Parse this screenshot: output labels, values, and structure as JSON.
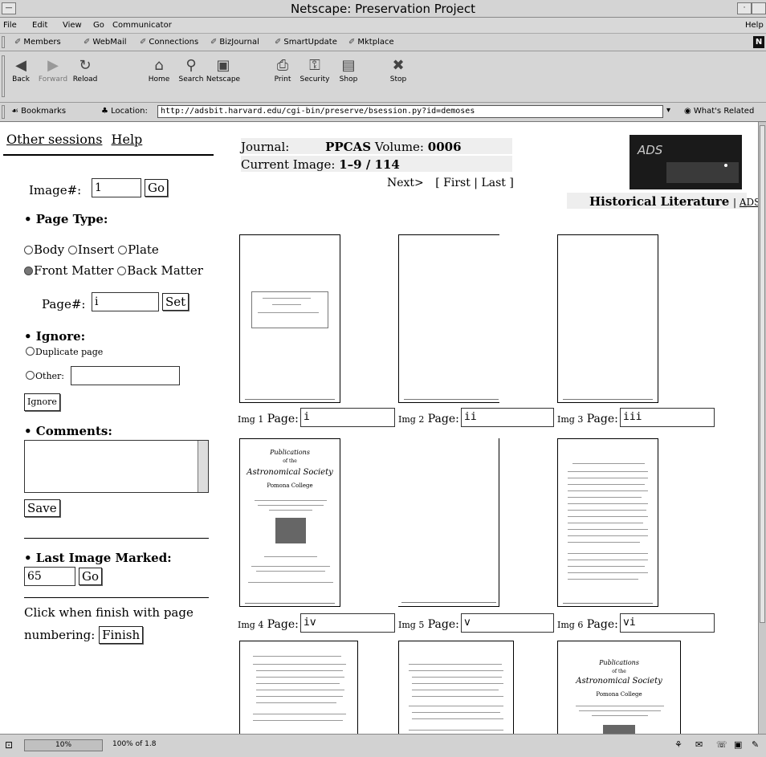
{
  "window": {
    "title": "Netscape: Preservation Project"
  },
  "menu": {
    "items": [
      "File",
      "Edit",
      "View",
      "Go",
      "Communicator"
    ],
    "help": "Help"
  },
  "personal_toolbar": {
    "items": [
      "Members",
      "WebMail",
      "Connections",
      "BizJournal",
      "SmartUpdate",
      "Mktplace"
    ]
  },
  "nav_buttons": [
    "Back",
    "Forward",
    "Reload",
    "Home",
    "Search",
    "Netscape",
    "Print",
    "Security",
    "Shop",
    "Stop"
  ],
  "location": {
    "bookmarks_label": "Bookmarks",
    "label": "Location:",
    "url": "http://adsbit.harvard.edu/cgi-bin/preserve/bsession.py?id=demoses",
    "whats_related": "What's Related"
  },
  "left_panel": {
    "links": {
      "other_sessions": "Other sessions",
      "help": "Help"
    },
    "image_label": "Image#:",
    "image_value": "1",
    "go_label": "Go",
    "page_type_heading": "• Page Type:",
    "radio_body": "Body",
    "radio_insert": "Insert",
    "radio_plate": "Plate",
    "radio_front": "Front Matter",
    "radio_back": "Back Matter",
    "page_label": "Page#:",
    "page_value": "i",
    "set_label": "Set",
    "ignore_heading": "• Ignore:",
    "dup_label": "Duplicate page",
    "other_label": "Other:",
    "ignore_button": "Ignore",
    "comments_heading": "• Comments:",
    "save_label": "Save",
    "last_heading": "• Last Image Marked:",
    "last_value": "65",
    "finish_text_1": "Click when finish with page",
    "finish_text_2": "numbering:",
    "finish_label": "Finish"
  },
  "header": {
    "journal_label": "Journal:",
    "journal_value": "PPCAS",
    "volume_label": "Volume:",
    "volume_value": "0006",
    "current_label": "Current Image:",
    "current_value": "1–9 / 114",
    "next_label": "Next>",
    "first_last": "[ First | Last ]",
    "historical": "Historical Literature",
    "ads_link": "ADS",
    "logo_text": "ADS"
  },
  "thumbs": [
    {
      "img": "Img 1",
      "page": "i"
    },
    {
      "img": "Img 2",
      "page": "ii"
    },
    {
      "img": "Img 3",
      "page": "iii"
    },
    {
      "img": "Img 4",
      "page": "iv"
    },
    {
      "img": "Img 5",
      "page": "v"
    },
    {
      "img": "Img 6",
      "page": "vi"
    }
  ],
  "page_word": "Page:",
  "thumb_text": {
    "pub1": "Publications",
    "pub2": "of the",
    "pub3": "Astronomical Society",
    "pub4": "Pomona College"
  },
  "status": {
    "progress": "10%",
    "detail": "100% of 1.8"
  }
}
